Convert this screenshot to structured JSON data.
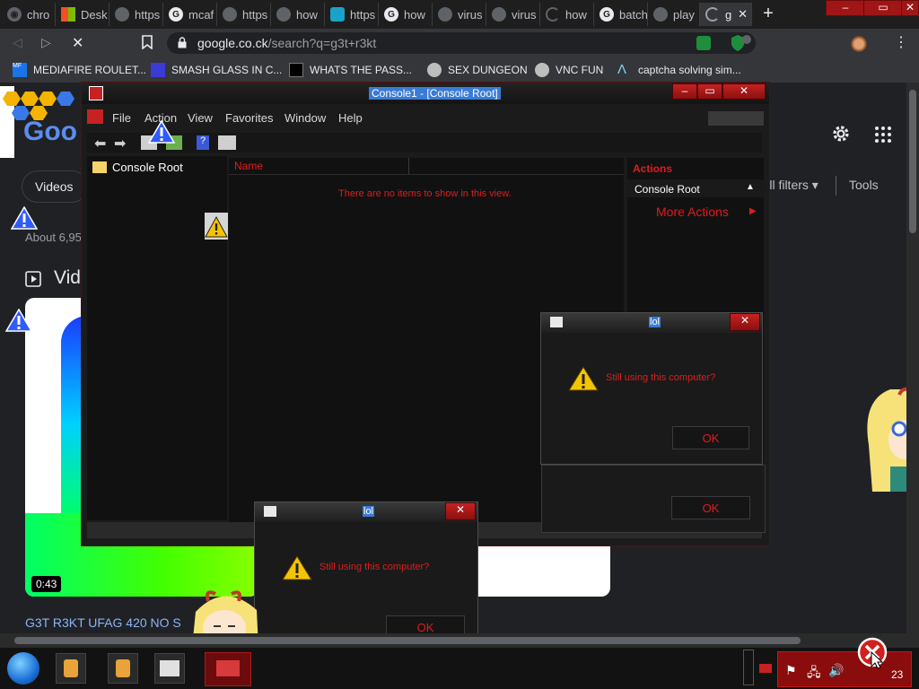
{
  "browser": {
    "tabs": [
      {
        "label": "chro",
        "favicon": "chrome-icon"
      },
      {
        "label": "Desk",
        "favicon": "windows-icon"
      },
      {
        "label": "https",
        "favicon": "globe-icon"
      },
      {
        "label": "mcaf",
        "favicon": "google-icon"
      },
      {
        "label": "https",
        "favicon": "globe-icon"
      },
      {
        "label": "how",
        "favicon": "globe-icon"
      },
      {
        "label": "https",
        "favicon": "edge-icon"
      },
      {
        "label": "how",
        "favicon": "google-icon"
      },
      {
        "label": "virus",
        "favicon": "globe-icon"
      },
      {
        "label": "virus",
        "favicon": "globe-icon"
      },
      {
        "label": "how",
        "favicon": "loading-icon"
      },
      {
        "label": "batch",
        "favicon": "google-icon"
      },
      {
        "label": "play",
        "favicon": "globe-icon"
      },
      {
        "label": "g",
        "favicon": "loading-icon",
        "active": true
      }
    ],
    "url_host": "google.co.ck",
    "url_path": "/search?q=g3t+r3kt",
    "bookmarks": [
      "MEDIAFIRE ROULET...",
      "SMASH GLASS IN C...",
      "WHATS THE PASS...",
      "SEX DUNGEON",
      "VNC FUN",
      "captcha solving sim..."
    ],
    "accent": "#a01515"
  },
  "google": {
    "chip_videos": "Videos",
    "all_filters": "All filters",
    "tools": "Tools",
    "about": "About 6,95",
    "videos_heading": "Vide",
    "duration": "0:43",
    "result_title": "G3T R3KT UFAG 420 NO S"
  },
  "mmc": {
    "title": "Console1 - [Console Root]",
    "menu": [
      "File",
      "Action",
      "View",
      "Favorites",
      "Window",
      "Help"
    ],
    "tree_root": "Console Root",
    "column_name": "Name",
    "empty_message": "There are no items to show in this view.",
    "actions_header": "Actions",
    "actions_item": "Console Root",
    "more_actions": "More Actions"
  },
  "dialogs": [
    {
      "title": "lol",
      "message": "Still using this computer?",
      "ok": "OK"
    },
    {
      "title": "lol",
      "message": "Still using this computer?",
      "ok": "OK"
    }
  ],
  "stray_ok": "OK",
  "taskbar": {
    "clock_fragment": "23"
  }
}
